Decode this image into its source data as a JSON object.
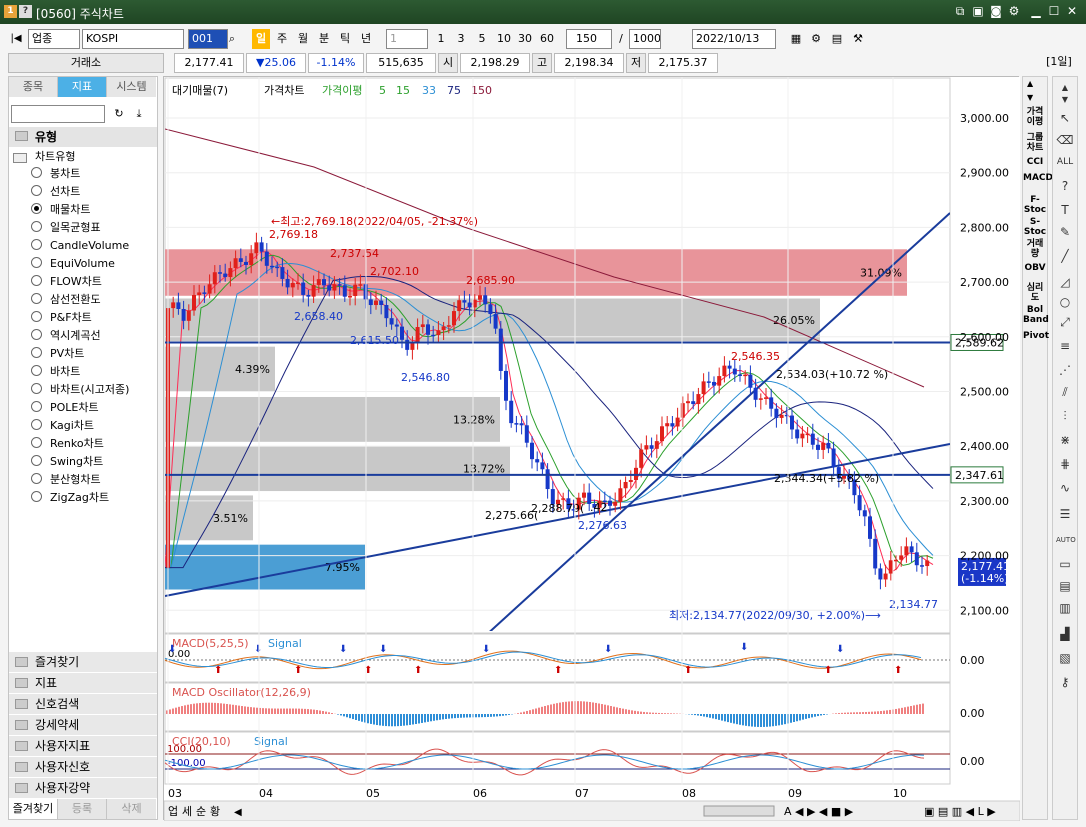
{
  "window": {
    "icon1": "1",
    "icon2": "?",
    "title": "[0560] 주식차트"
  },
  "toolbar": {
    "market": "업종",
    "index_name": "KOSPI",
    "code": "001",
    "periods": [
      "일",
      "주",
      "월",
      "분",
      "틱",
      "년"
    ],
    "interval": "1",
    "intervals": [
      "1",
      "3",
      "5",
      "10",
      "30",
      "60"
    ],
    "count": "150",
    "total": "1000",
    "date": "2022/10/13",
    "slash": "/"
  },
  "quote": {
    "label": "거래소",
    "price": "2,177.41",
    "change": "▼25.06",
    "pct": "-1.14%",
    "volume": "515,635",
    "open_label": "시",
    "open": "2,198.29",
    "high_label": "고",
    "high": "2,198.34",
    "low_label": "저",
    "low": "2,175.37",
    "period_badge": "[1일]"
  },
  "left": {
    "tabs": [
      "종목",
      "지표",
      "시스템"
    ],
    "section_title": "유형",
    "subtitle": "차트유형",
    "types": [
      "봉차트",
      "선차트",
      "매물차트",
      "일목균형표",
      "CandleVolume",
      "EquiVolume",
      "FLOW차트",
      "삼선전환도",
      "P&F차트",
      "역시계곡선",
      "PV차트",
      "바차트",
      "바차트(시고저종)",
      "POLE차트",
      "Kagi차트",
      "Renko차트",
      "Swing차트",
      "분산형차트",
      "ZigZag차트"
    ],
    "selected": 2,
    "sections": [
      "즐겨찾기",
      "지표",
      "신호검색",
      "강세약세",
      "사용자지표",
      "사용자신호",
      "사용자강약"
    ],
    "bottom_tabs": [
      "즐겨찾기",
      "등록",
      "삭제"
    ]
  },
  "chart": {
    "legend": {
      "vol": "대기매물(7)",
      "price": "가격차트",
      "ma": "가격이평",
      "ma5": "5",
      "ma15": "15",
      "ma33": "33",
      "ma75": "75",
      "ma150": "150"
    },
    "y_ticks": [
      "3,000.00",
      "2,900.00",
      "2,800.00",
      "2,700.00",
      "2,600.00",
      "2,500.00",
      "2,400.00",
      "2,300.00",
      "2,200.00",
      "2,100.00"
    ],
    "x_ticks": [
      "03",
      "04",
      "05",
      "06",
      "07",
      "08",
      "09",
      "10"
    ],
    "annotations": {
      "high_note": "←최고:2,769.18(2022/04/05, -21.37%)",
      "low_note": "최저:2,134.77(2022/09/30, +2.00%)⟶",
      "p1": "2,769.18",
      "p2": "2,737.54",
      "p3": "2,702.10",
      "p4": "2,685.90",
      "p5": "2,658.40",
      "p6": "2,615.50",
      "p7": "2,546.80",
      "p8": "2,546.35",
      "p9": "2,534.03(+10.72 %)",
      "p10": "2,344.34(+5.82 %)",
      "p11": "2,288.79(",
      "p12": ".42",
      "p13": "2,275.66(",
      "p14": "2,276.63",
      "p15": "2,134.77"
    },
    "vol_profile": [
      {
        "pct": "31.09%",
        "lo": 2675,
        "hi": 2760,
        "color": "#e8949a"
      },
      {
        "pct": "26.05%",
        "lo": 2592,
        "hi": 2670,
        "color": "#c8c8c8"
      },
      {
        "pct": "4.39%",
        "lo": 2500,
        "hi": 2582,
        "color": "#c8c8c8"
      },
      {
        "pct": "13.28%",
        "lo": 2408,
        "hi": 2490,
        "color": "#c8c8c8"
      },
      {
        "pct": "13.72%",
        "lo": 2318,
        "hi": 2400,
        "color": "#c8c8c8"
      },
      {
        "pct": "3.51%",
        "lo": 2228,
        "hi": 2310,
        "color": "#c8c8c8"
      },
      {
        "pct": "7.95%",
        "lo": 2138,
        "hi": 2220,
        "color": "#4b9ed4"
      }
    ],
    "h_lines": [
      {
        "label": "2,589.62",
        "value": 2589.62
      },
      {
        "label": "2,347.61",
        "value": 2347.61
      }
    ],
    "last_price": "2,177.41",
    "last_pct": "(-1.14%)",
    "macd_title": "MACD(5,25,5)",
    "macd_signal": "Signal",
    "macd_zero": "0.00",
    "macd_val": "0.00",
    "osc_title": "MACD Oscillator(12,26,9)",
    "osc_val": "0.00",
    "cci_title": "CCI(20,10)",
    "cci_signal": "Signal",
    "cci_top": "100.00",
    "cci_bot": "-100.00",
    "cci_val": "0.00",
    "bottom_bar": [
      "업",
      "세",
      "순",
      "황"
    ]
  },
  "right_tools": [
    "가격이평",
    "그룹차트",
    "CCI",
    "MACD",
    "F-Stoc",
    "S-Stoc",
    "거래량",
    "OBV",
    "심리도",
    "Bol Band",
    "Pivot"
  ]
}
